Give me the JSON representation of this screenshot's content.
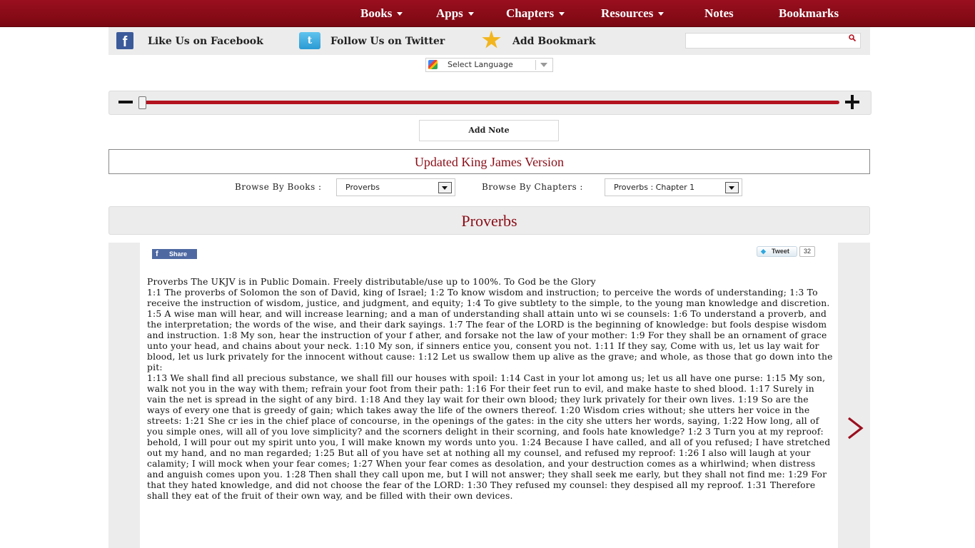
{
  "nav": {
    "books": "Books",
    "apps": "Apps",
    "chapters": "Chapters",
    "resources": "Resources",
    "notes": "Notes",
    "bookmarks": "Bookmarks"
  },
  "social": {
    "facebook": "Like Us on Facebook",
    "twitter": "Follow Us on Twitter",
    "bookmark": "Add Bookmark",
    "search_placeholder": ""
  },
  "language": {
    "label": "Select Language"
  },
  "add_note": "Add Note",
  "version": "Updated King James Version",
  "browse": {
    "books_label": "Browse By Books :",
    "books_value": "Proverbs",
    "chapters_label": "Browse By Chapters :",
    "chapters_value": "Proverbs : Chapter 1"
  },
  "book_title": "Proverbs",
  "share": {
    "fb_share": "Share",
    "tweet": "Tweet",
    "tweet_count": "32"
  },
  "text": {
    "intro": "Proverbs The UKJV is in Public Domain. Freely distributable/use up to 100%. To God be the Glory",
    "para1": "1:1 The proverbs of Solomon the son of David, king of Israel; 1:2 To know wisdom and instruction; to perceive the words of understanding; 1:3 To receive the instruction of wisdom, justice, and judgment, and equity; 1:4 To give subtlety to the simple, to the young man knowledge and discretion. 1:5 A wise man will hear, and will increase learning; and a man of understanding shall attain unto wi se counsels: 1:6 To understand a proverb, and the interpretation; the words of the wise, and their dark sayings. 1:7 The fear of the LORD is the beginning of knowledge: but fools despise wisdom and instruction. 1:8 My son, hear the instruction of your f ather, and forsake not the law of your mother: 1:9 For they shall be an ornament of grace unto your head, and chains about your neck. 1:10 My son, if sinners entice you, consent you not. 1:11 If they say, Come with us, let us lay wait for blood, let us lurk privately for the innocent without cause: 1:12 Let us swallow them up alive as the grave; and whole, as those that go down into the pit:",
    "para2": "1:13 We shall find all precious substance, we shall fill our houses with spoil: 1:14 Cast in your lot among us; let us all have one purse: 1:15 My son, walk not you in the way with them; refrain your foot from their path: 1:16 For their feet run to evil, and make haste to shed blood. 1:17 Surely in vain the net is spread in the sight of any bird. 1:18 And they lay wait for their own blood; they lurk privately for their own lives. 1:19 So are the ways of every one that is greedy of gain; which takes away the life of the owners thereof. 1:20 Wisdom cries without; she utters her voice in the streets: 1:21 She cr ies in the chief place of concourse, in the openings of the gates: in the city she utters her words, saying, 1:22 How long, all of you simple ones, will all of you love simplicity? and the scorners delight in their scorning, and fools hate knowledge? 1:2 3 Turn you at my reproof: behold, I will pour out my spirit unto you, I will make known my words unto you. 1:24 Because I have called, and all of you refused; I have stretched out my hand, and no man regarded; 1:25 But all of you have set at nothing all my counsel, and refused my reproof: 1:26 I also will laugh at your calamity; I will mock when your fear comes; 1:27 When your fear comes as desolation, and your destruction comes as a whirlwind; when distress and anguish comes upon you. 1:28 Then shall they call upon me, but I will not answer; they shall seek me early, but they shall not find me: 1:29 For that they hated knowledge, and did not choose the fear of the LORD: 1:30 They refused my counsel: they despised all my reproof. 1:31 Therefore shall they eat of the fruit of their own way, and be filled with their own devices."
  },
  "colors": {
    "brand": "#8a0d17",
    "nav_bg": "#8b0c18",
    "panel_bg": "#ececec"
  },
  "icons": {
    "caret": "chevron-down-icon",
    "facebook": "facebook-icon",
    "twitter": "twitter-icon",
    "bookmark": "star-icon",
    "search": "search-icon",
    "zoom_out": "minus-icon",
    "zoom_in": "plus-icon",
    "next": "chevron-right-icon"
  }
}
